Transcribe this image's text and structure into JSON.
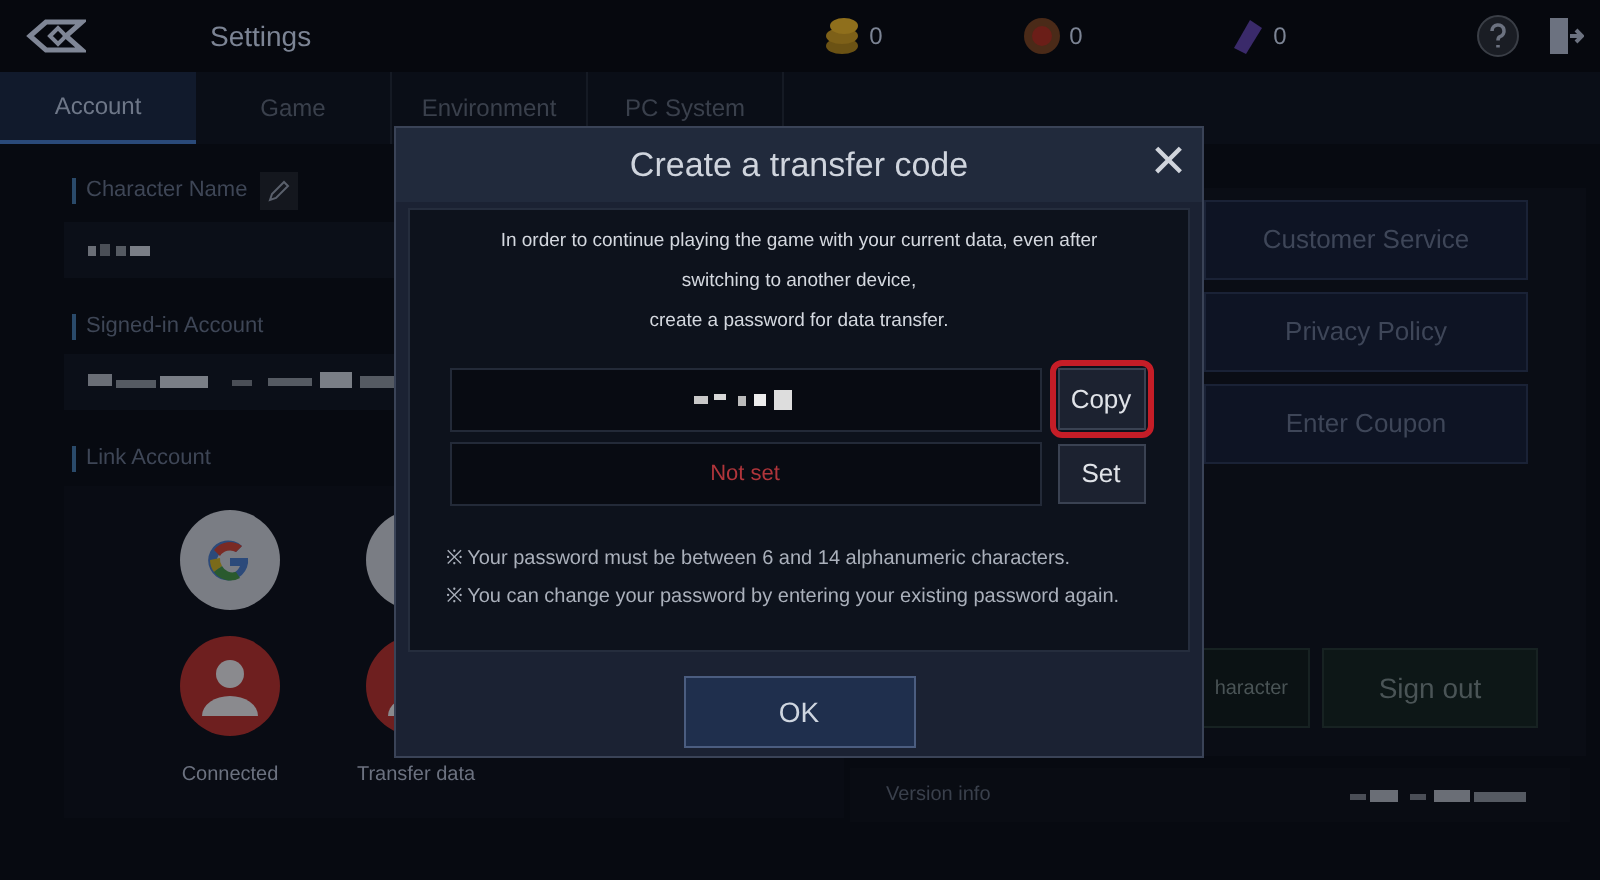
{
  "top_bar": {
    "title": "Settings",
    "currencies": [
      {
        "kind": "gold",
        "amount": "0"
      },
      {
        "kind": "medal",
        "amount": "0"
      },
      {
        "kind": "crystal",
        "amount": "0"
      }
    ]
  },
  "tabs": [
    {
      "label": "Account",
      "selected": true
    },
    {
      "label": "Game",
      "selected": false
    },
    {
      "label": "Environment",
      "selected": false
    },
    {
      "label": "PC System",
      "selected": false
    }
  ],
  "account": {
    "character_name_label": "Character Name",
    "signed_in_label": "Signed-in Account",
    "link_account_label": "Link Account",
    "link_options": [
      {
        "kind": "google",
        "label": "Connected"
      },
      {
        "kind": "transfer",
        "label": "Transfer data"
      }
    ]
  },
  "right_menu": [
    "Customer Service",
    "Privacy Policy",
    "Enter Coupon"
  ],
  "bottom_buttons": [
    {
      "kind": "plain",
      "label": "haracter"
    },
    {
      "kind": "accent",
      "label": "Sign out"
    }
  ],
  "version": {
    "label": "Version info"
  },
  "dialog": {
    "title": "Create a transfer code",
    "close": "×",
    "description_lines": [
      "In order to continue playing the game with your current data, even after switching to another device,",
      "create a password for data transfer."
    ],
    "copy_label": "Copy",
    "copy_highlighted": true,
    "password_status": "Not set",
    "set_label": "Set",
    "notes": [
      "※ Your password must be between 6 and 14 alphanumeric characters.",
      "※ You can change your password by entering your existing password again."
    ],
    "ok_label": "OK"
  }
}
